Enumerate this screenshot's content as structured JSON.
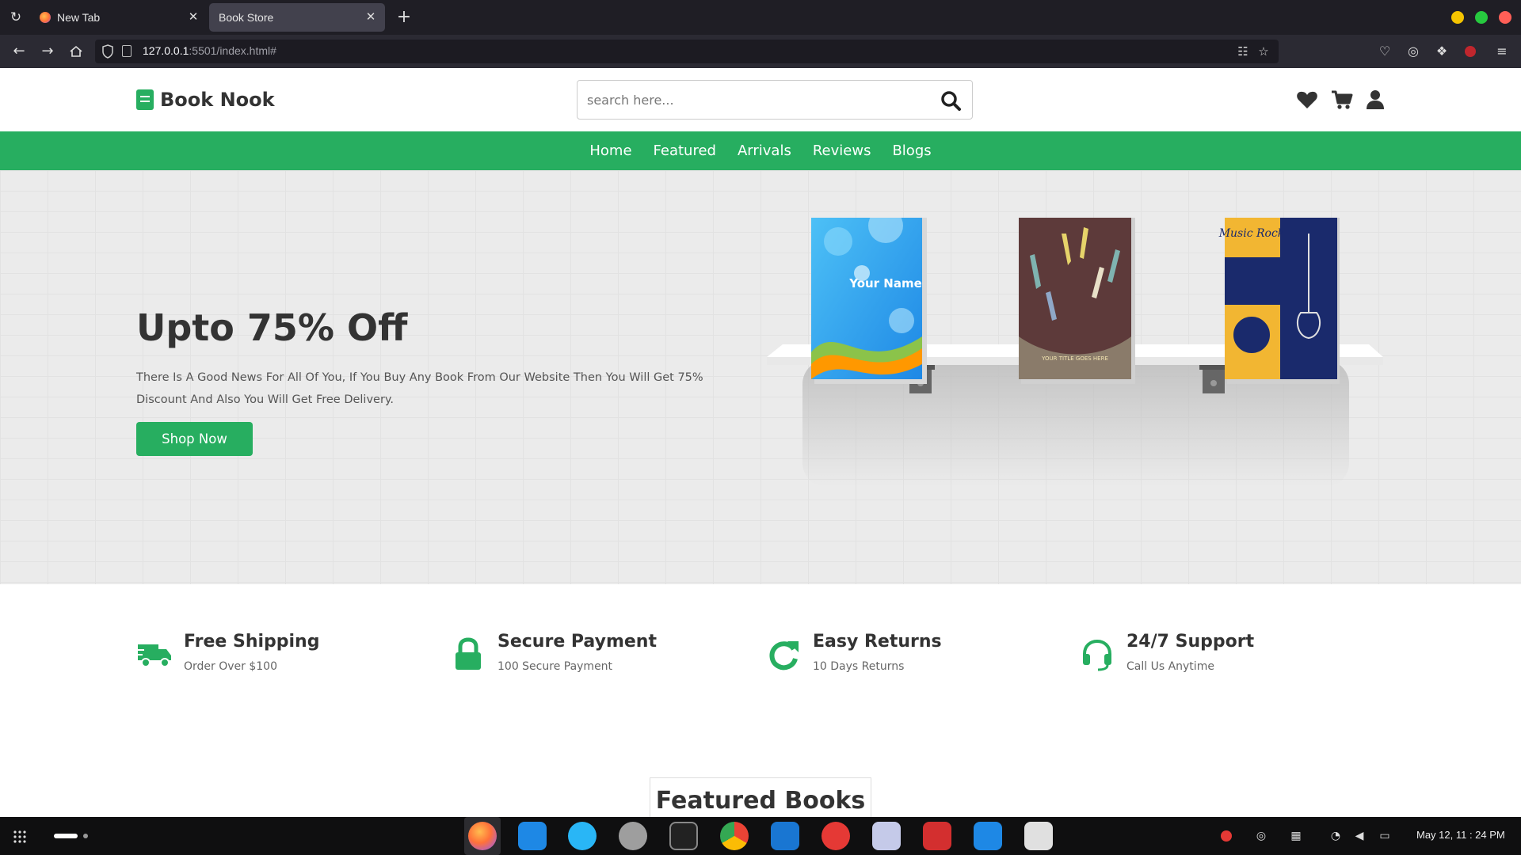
{
  "browser": {
    "tabs": [
      {
        "label": "New Tab",
        "active": false
      },
      {
        "label": "Book Store",
        "active": true
      }
    ],
    "url_host": "127.0.0.1",
    "url_rest": ":5501/index.html#"
  },
  "site": {
    "logo": "Book Nook",
    "search_placeholder": "search here...",
    "nav": [
      "Home",
      "Featured",
      "Arrivals",
      "Reviews",
      "Blogs"
    ],
    "hero": {
      "title": "Upto 75% Off",
      "description": "There Is A Good News For All Of You, If You Buy Any Book From Our Website Then You Will Get 75% Discount And Also You Will Get Free Delivery.",
      "button": "Shop Now"
    },
    "books": [
      {
        "cover_text": "Your Name"
      },
      {
        "cover_text": "YOUR TITLE GOES HERE"
      },
      {
        "cover_text": "Music Rock"
      }
    ],
    "features": [
      {
        "icon": "truck-icon",
        "title": "Free Shipping",
        "subtitle": "Order Over $100"
      },
      {
        "icon": "lock-icon",
        "title": "Secure Payment",
        "subtitle": "100 Secure Payment"
      },
      {
        "icon": "redo-icon",
        "title": "Easy Returns",
        "subtitle": "10 Days Returns"
      },
      {
        "icon": "headset-icon",
        "title": "24/7 Support",
        "subtitle": "Call Us Anytime"
      }
    ],
    "featured_heading": "Featured Books",
    "accent_color": "#27ae60"
  },
  "taskbar": {
    "clock": "May 12, 11 : 24 PM"
  }
}
